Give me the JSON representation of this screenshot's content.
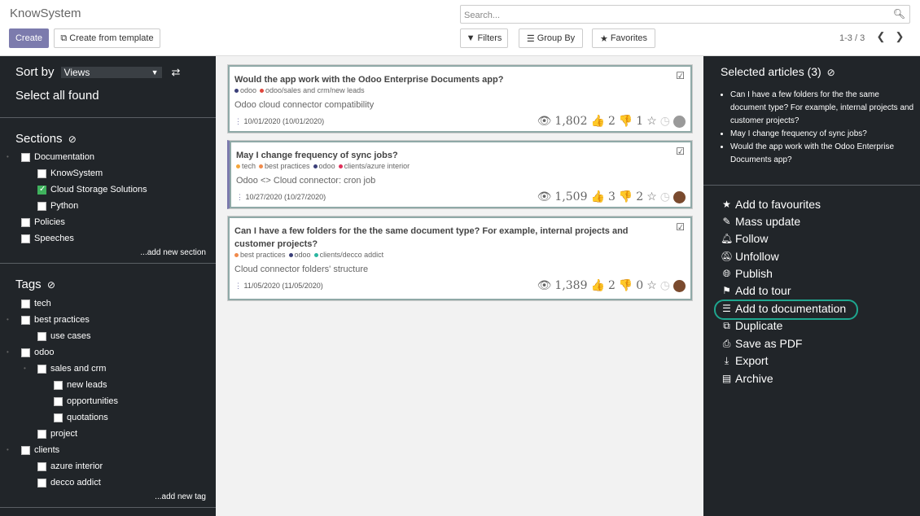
{
  "app": {
    "title": "KnowSystem"
  },
  "toolbar": {
    "create": "Create",
    "create_template": "Create from template",
    "filters": "Filters",
    "group_by": "Group By",
    "favorites": "Favorites",
    "pager": "1-3 / 3"
  },
  "search": {
    "placeholder": "Search..."
  },
  "left": {
    "sort_by": "Sort by",
    "sort_value": "Views",
    "select_all": "Select all found",
    "sections_title": "Sections",
    "sections": [
      {
        "label": "Documentation",
        "checked": false
      },
      {
        "label": "KnowSystem",
        "checked": false
      },
      {
        "label": "Cloud Storage Solutions",
        "checked": true
      },
      {
        "label": "Python",
        "checked": false
      },
      {
        "label": "Policies",
        "checked": false
      },
      {
        "label": "Speeches",
        "checked": false
      }
    ],
    "add_section": "...add new section",
    "tags_title": "Tags",
    "tags": [
      {
        "label": "tech"
      },
      {
        "label": "best practices"
      },
      {
        "label": "use cases"
      },
      {
        "label": "odoo"
      },
      {
        "label": "sales and crm"
      },
      {
        "label": "new leads"
      },
      {
        "label": "opportunities"
      },
      {
        "label": "quotations"
      },
      {
        "label": "project"
      },
      {
        "label": "clients"
      },
      {
        "label": "azure interior"
      },
      {
        "label": "decco addict"
      }
    ],
    "add_tag": "...add new tag"
  },
  "cards": [
    {
      "title": "Would the app work with the Odoo Enterprise Documents app?",
      "tags": [
        {
          "label": "odoo",
          "color": "#3b3f79"
        },
        {
          "label": "odoo/sales and crm/new leads",
          "color": "#e0473d"
        }
      ],
      "subtitle": "Odoo cloud connector compatibility",
      "date": "10/01/2020 (10/01/2020)",
      "views": "1,802",
      "likes": "2",
      "dislikes": "1"
    },
    {
      "title": "May I change frequency of sync jobs?",
      "tags": [
        {
          "label": "tech",
          "color": "#f4a63b"
        },
        {
          "label": "best practices",
          "color": "#f08a4b"
        },
        {
          "label": "odoo",
          "color": "#3b3f79"
        },
        {
          "label": "clients/azure interior",
          "color": "#e0305a"
        }
      ],
      "subtitle": "Odoo <> Cloud connector: cron job",
      "date": "10/27/2020 (10/27/2020)",
      "views": "1,509",
      "likes": "3",
      "dislikes": "2"
    },
    {
      "title": "Can I have a few folders for the the same document type? For example, internal projects and customer projects?",
      "tags": [
        {
          "label": "best practices",
          "color": "#f08a4b"
        },
        {
          "label": "odoo",
          "color": "#3b3f79"
        },
        {
          "label": "clients/decco addict",
          "color": "#2bb5a0"
        }
      ],
      "subtitle": "Cloud connector folders' structure",
      "date": "11/05/2020 (11/05/2020)",
      "views": "1,389",
      "likes": "2",
      "dislikes": "0"
    }
  ],
  "right": {
    "selected_title": "Selected articles (3)",
    "selected": [
      "Can I have a few folders for the the same document type? For example, internal projects and customer projects?",
      "May I change frequency of sync jobs?",
      "Would the app work with the Odoo Enterprise Documents app?"
    ],
    "actions": [
      "Add to favourites",
      "Mass update",
      "Follow",
      "Unfollow",
      "Publish",
      "Add to tour",
      "Add to documentation",
      "Duplicate",
      "Save as PDF",
      "Export",
      "Archive"
    ]
  }
}
